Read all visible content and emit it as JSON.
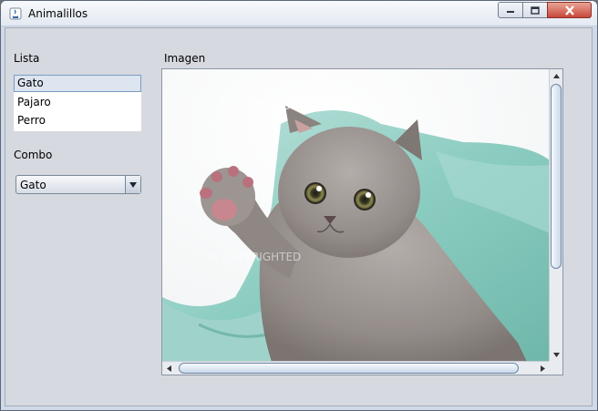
{
  "window": {
    "title": "Animalillos"
  },
  "lista": {
    "label": "Lista",
    "items": [
      "Gato",
      "Pajaro",
      "Perro"
    ],
    "selected": "Gato"
  },
  "combo": {
    "label": "Combo",
    "value": "Gato"
  },
  "imagen": {
    "label": "Imagen",
    "subject": "gray kitten waving paw on teal blanket",
    "watermark": "© COPYRIGHTED"
  },
  "colors": {
    "window_bg": "#d6d9df",
    "selection_border": "#7a9cc4",
    "close_button": "#c8483a"
  }
}
